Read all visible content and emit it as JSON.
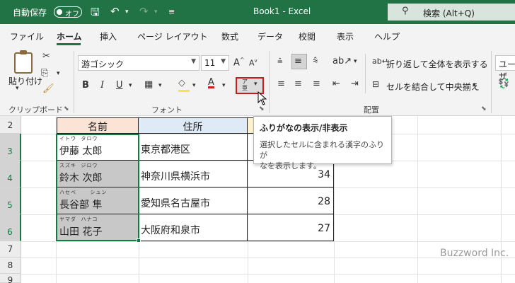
{
  "titlebar": {
    "autosave_label": "自動保存",
    "autosave_state": "オフ",
    "title": "Book1  -  Excel",
    "search_placeholder": "検索 (Alt+Q)"
  },
  "tabs": [
    "ファイル",
    "ホーム",
    "挿入",
    "ページ レイアウト",
    "数式",
    "データ",
    "校閲",
    "表示",
    "ヘルプ"
  ],
  "active_tab": "ホーム",
  "ribbon": {
    "clipboard": {
      "paste_label": "貼り付け",
      "group_label": "クリップボード"
    },
    "font": {
      "font_name": "游ゴシック",
      "font_size": "11",
      "bold": "B",
      "italic": "I",
      "underline": "U",
      "grow": "A",
      "shrink": "A",
      "group_label": "フォント"
    },
    "alignment": {
      "wrap_text": "折り返して全体を表示する",
      "merge_center": "セルを結合して中央揃え",
      "group_label": "配置"
    },
    "number_format_partial": "ユーザ"
  },
  "tooltip": {
    "title": "ふりがなの表示/非表示",
    "body_line1": "選択したセルに含まれる漢字のふりが",
    "body_line2": "なを表示します。"
  },
  "grid": {
    "rows": [
      "2",
      "3",
      "4",
      "5",
      "6",
      "7",
      "8",
      "9"
    ],
    "header": {
      "name": "名前",
      "address": "住所"
    },
    "records": [
      {
        "ruby": "イトウ  タロウ",
        "name": "伊藤 太郎",
        "address": "東京都港区",
        "age": ""
      },
      {
        "ruby": "スズキ  ジロウ",
        "name": "鈴木 次郎",
        "address": "神奈川県横浜市",
        "age": "34"
      },
      {
        "ruby": "ハセベ      シュン",
        "name": "長谷部 隼",
        "address": "愛知県名古屋市",
        "age": "28"
      },
      {
        "ruby": "ヤマダ  ハナコ",
        "name": "山田 花子",
        "address": "大阪府和泉市",
        "age": "27"
      }
    ]
  },
  "watermark": "Buzzword Inc.",
  "colors": {
    "excel_green": "#217346",
    "highlight_red": "#d0181e"
  }
}
